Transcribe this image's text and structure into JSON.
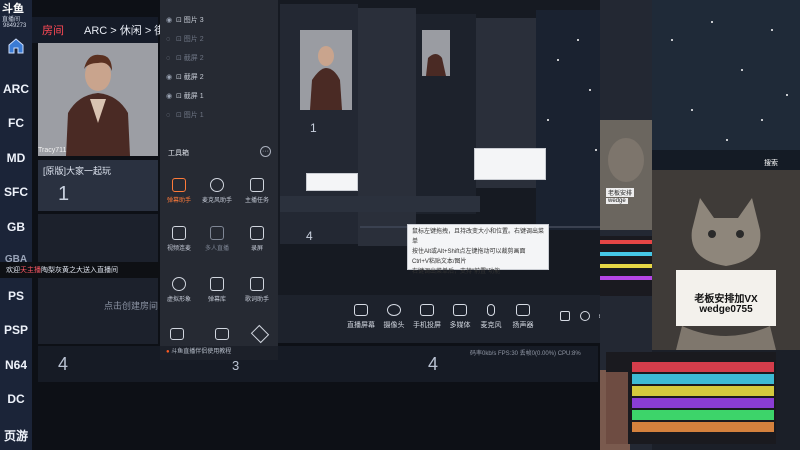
{
  "nav": {
    "logo": "斗鱼",
    "sub": "直播间",
    "uid": "9849273",
    "items": [
      "ARC",
      "FC",
      "MD",
      "SFC",
      "GB",
      "GBA",
      "PS",
      "PSP",
      "N64",
      "DC",
      "页游"
    ]
  },
  "header": {
    "fav": "房间",
    "breadcrumb": "ARC > 休闲 > 街头"
  },
  "stream": {
    "streamer_name": "Tracy711",
    "room_title": "[原版]大家一起玩",
    "room_number": "1",
    "create_room": "点击创建房间",
    "bottom_numbers": [
      "4",
      "3",
      "4"
    ]
  },
  "danmu": {
    "pre": "欢迎",
    "name": "夭主播",
    "post": "陶梨灰黄之大送入直播间"
  },
  "layers": {
    "rows": [
      "图片 3",
      "图片 2",
      "截屏 2",
      "截屏 2",
      "截屏 1",
      "图片 1"
    ]
  },
  "tools": {
    "title": "工具箱",
    "more": "···",
    "items": [
      {
        "label": "弹幕助手",
        "active": true
      },
      {
        "label": "麦克风助手",
        "active": false
      },
      {
        "label": "主播任务",
        "active": false
      },
      {
        "label": "视频连麦",
        "active": false
      },
      {
        "label": "多人直播",
        "active": false
      },
      {
        "label": "录屏",
        "active": false
      },
      {
        "label": "虚拟形象",
        "active": false
      },
      {
        "label": "弹幕库",
        "active": false
      },
      {
        "label": "歌词助手",
        "active": false
      }
    ],
    "tip": "斗鱼直播伴侣使用教程"
  },
  "controls": [
    {
      "label": "直播屏幕"
    },
    {
      "label": "摄像头"
    },
    {
      "label": "手机投屏"
    },
    {
      "label": "多媒体"
    },
    {
      "label": "麦克风"
    },
    {
      "label": "扬声器"
    }
  ],
  "status": "码率0kb/s   FPS:30   丢帧0(0.00%)   CPU:8%",
  "tip_box": {
    "line1": "鼠标左键拖拽，且持改变大小和位置。右键调出菜单",
    "line2": "按住Alt或Alt+Shift点左键拖动可以裁剪画面",
    "line3": "Ctrl+V粘贴文本/图片",
    "line4": "右键调出菜单后，支持\"前置\"功能"
  },
  "cat": {
    "line1": "老板安排加VX",
    "line2": "wedge0755",
    "small": "wedge",
    "small_top": "老板安排"
  },
  "search": "搜索"
}
